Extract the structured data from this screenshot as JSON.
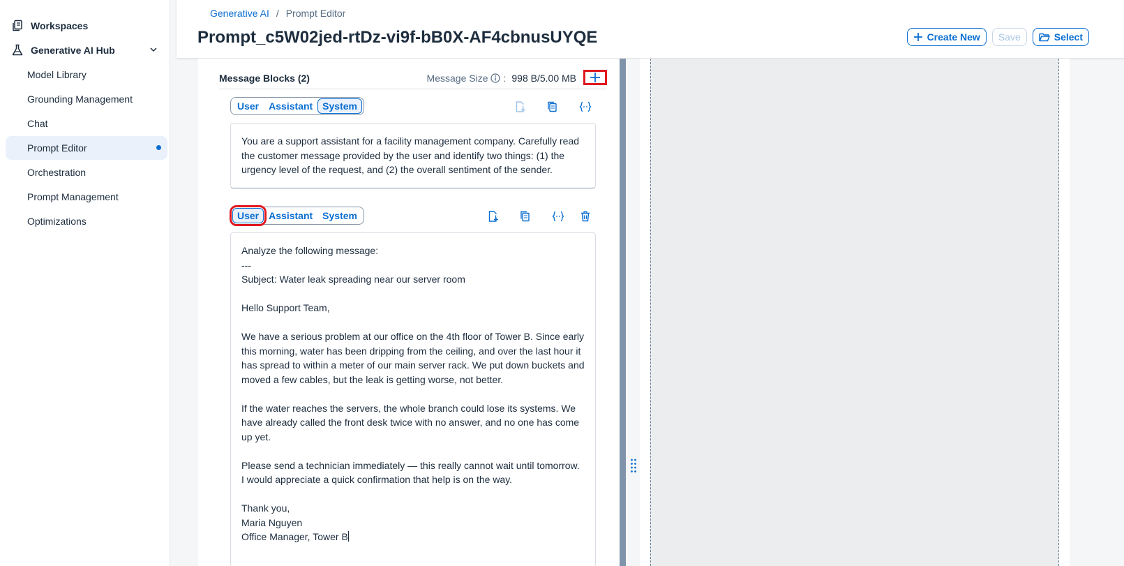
{
  "sidebar": {
    "workspaces": "Workspaces",
    "hub": "Generative AI Hub",
    "items": [
      {
        "label": "Model Library"
      },
      {
        "label": "Grounding Management"
      },
      {
        "label": "Chat"
      },
      {
        "label": "Prompt Editor"
      },
      {
        "label": "Orchestration"
      },
      {
        "label": "Prompt Management"
      },
      {
        "label": "Optimizations"
      }
    ],
    "active_item": "Prompt Editor"
  },
  "header": {
    "breadcrumb": {
      "parent": "Generative AI",
      "separator": "/",
      "current": "Prompt Editor"
    },
    "title": "Prompt_c5W02jed-rtDz-vi9f-bB0X-AF4cbnusUYQE",
    "create_new": "Create New",
    "save": "Save",
    "select": "Select"
  },
  "message_blocks": {
    "title": "Message Blocks (2)",
    "size_label": "Message Size",
    "size_colon": ":",
    "size_value": "998 B/5.00 MB",
    "roles": [
      "User",
      "Assistant",
      "System"
    ],
    "blocks": [
      {
        "selected_role": "System",
        "text": "You are a support assistant for a facility management company. Carefully read the customer message provided by the user and identify two things: (1) the urgency level of the request, and (2) the overall sentiment of the sender."
      },
      {
        "selected_role": "User",
        "text": "Analyze the following message:\n---\nSubject: Water leak spreading near our server room\n\nHello Support Team,\n\nWe have a serious problem at our office on the 4th floor of Tower B. Since early this morning, water has been dripping from the ceiling, and over the last hour it has spread to within a meter of our main server rack. We put down buckets and moved a few cables, but the leak is getting worse, not better.\n\nIf the water reaches the servers, the whole branch could lose its systems. We have already called the front desk twice with no answer, and no one has come up yet.\n\nPlease send a technician immediately — this really cannot wait until tomorrow. I would appreciate a quick confirmation that help is on the way.\n\nThank you,\nMaria Nguyen\nOffice Manager, Tower B"
      }
    ]
  },
  "colors": {
    "accent": "#0a6ed1",
    "highlight": "#e0191f",
    "divider": "#7f94ab"
  }
}
